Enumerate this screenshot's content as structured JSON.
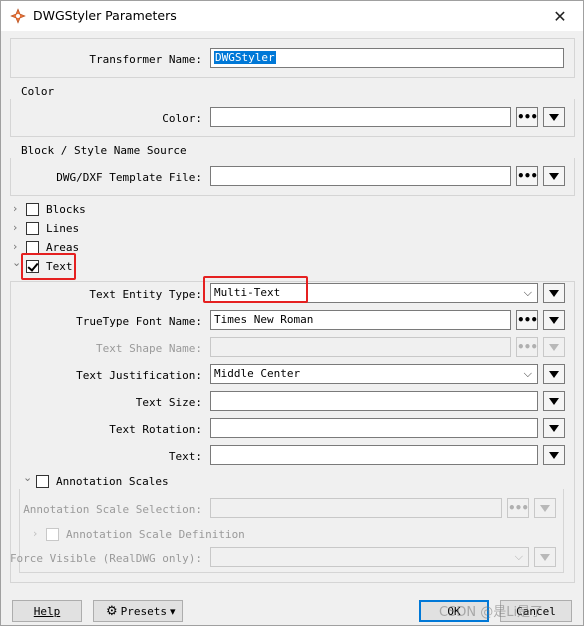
{
  "window": {
    "title": "DWGStyler Parameters",
    "close_glyph": "✕"
  },
  "transformer": {
    "label": "Transformer Name:",
    "value": "DWGStyler"
  },
  "color_group": {
    "title": "Color",
    "label": "Color:",
    "value": ""
  },
  "block_group": {
    "title": "Block / Style Name Source",
    "label": "DWG/DXF Template File:",
    "value": ""
  },
  "sections": {
    "blocks": "Blocks",
    "lines": "Lines",
    "areas": "Areas",
    "text": "Text"
  },
  "text_section": {
    "entity_type_label": "Text Entity Type:",
    "entity_type_value": "Multi-Text",
    "font_label": "TrueType Font Name:",
    "font_value": "Times New Roman",
    "shape_label": "Text Shape Name:",
    "shape_value": "",
    "justification_label": "Text Justification:",
    "justification_value": "Middle Center",
    "size_label": "Text Size:",
    "size_value": "",
    "rotation_label": "Text Rotation:",
    "rotation_value": "",
    "text_label": "Text:",
    "text_value": ""
  },
  "annotation": {
    "title": "Annotation Scales",
    "selection_label": "Annotation Scale Selection:",
    "selection_value": "",
    "definition_title": "Annotation Scale Definition",
    "force_label": "Force Visible (RealDWG only):",
    "force_value": ""
  },
  "glyphs": {
    "dots": "•••",
    "chevron_right": "›",
    "chevron_down": "⌄",
    "combo": "⌵",
    "gear": "⚙"
  },
  "footer": {
    "help": "Help",
    "presets": "Presets",
    "presets_arrow": "▾",
    "ok": "OK",
    "cancel": "Cancel"
  },
  "watermark": "CSDN @是Li是了",
  "colors": {
    "highlight": "#e52020",
    "selection": "#0078d7"
  }
}
